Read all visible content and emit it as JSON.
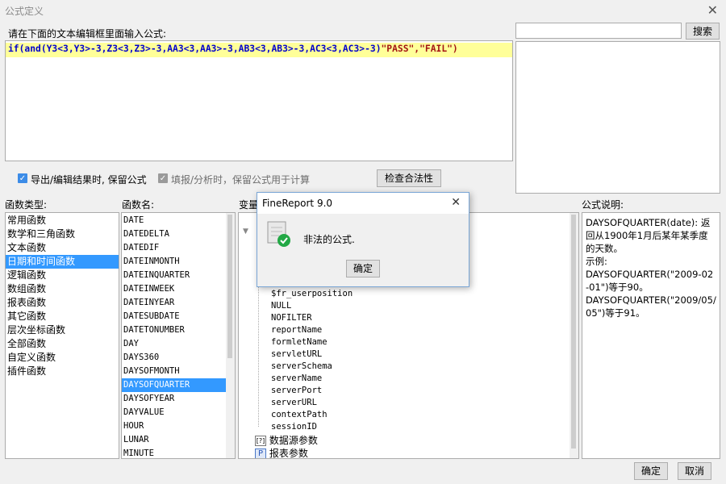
{
  "window": {
    "title": "公式定义"
  },
  "formula": {
    "prompt_label": "请在下面的文本编辑框里面输入公式:",
    "tokens": [
      {
        "text": "if(",
        "color": "#0000cc"
      },
      {
        "text": "and",
        "color": "#0000cc"
      },
      {
        "text": "(Y3<3,Y3>-3,Z3<3,Z3>-3,AA3<3,AA3>-3,AB3<3,AB3>-3,AC3<3,AC3>-3)",
        "color": "#0000cc"
      },
      {
        "text": "\"PASS\",\"FAIL\")",
        "color": "#a31515"
      }
    ]
  },
  "search": {
    "button_label": "搜索",
    "value": ""
  },
  "options": {
    "keep_formula_export": "导出/编辑结果时, 保留公式",
    "keep_formula_fill": "填报/分析时，保留公式用于计算",
    "check_button": "检查合法性"
  },
  "function_types": {
    "label": "函数类型:",
    "items": [
      "常用函数",
      "数学和三角函数",
      "文本函数",
      "日期和时间函数",
      "逻辑函数",
      "数组函数",
      "报表函数",
      "其它函数",
      "层次坐标函数",
      "全部函数",
      "自定义函数",
      "插件函数"
    ],
    "selected": "日期和时间函数"
  },
  "function_names": {
    "label": "函数名:",
    "items": [
      "DATE",
      "DATEDELTA",
      "DATEDIF",
      "DATEINMONTH",
      "DATEINQUARTER",
      "DATEINWEEK",
      "DATEINYEAR",
      "DATESUBDATE",
      "DATETONUMBER",
      "DAY",
      "DAYS360",
      "DAYSOFMONTH",
      "DAYSOFQUARTER",
      "DAYSOFYEAR",
      "DAYVALUE",
      "HOUR",
      "LUNAR",
      "MINUTE"
    ],
    "selected": "DAYSOFQUARTER"
  },
  "variables": {
    "label": "变量",
    "items": [
      "$fr_userposition",
      "NULL",
      "NOFILTER",
      "reportName",
      "formletName",
      "servletURL",
      "serverSchema",
      "serverName",
      "serverPort",
      "serverURL",
      "contextPath",
      "sessionID"
    ],
    "datasource_params": "数据源参数",
    "report_params": "报表参数"
  },
  "description": {
    "label": "公式说明:",
    "lines": [
      "DAYSOFQUARTER(date): 返回从1900年1月后某年某季度的天数。",
      "示例:",
      "DAYSOFQUARTER(\"2009-02-01\")等于90。",
      "DAYSOFQUARTER(\"2009/05/05\")等于91。"
    ]
  },
  "footer": {
    "ok": "确定",
    "cancel": "取消"
  },
  "modal": {
    "title": "FineReport 9.0",
    "message": "非法的公式.",
    "ok": "确定",
    "close": "✕"
  }
}
